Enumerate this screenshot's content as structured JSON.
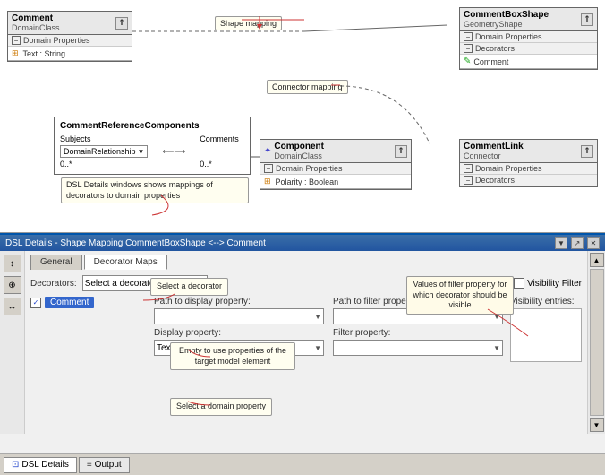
{
  "diagram": {
    "boxes": {
      "comment": {
        "title": "Comment",
        "subtitle": "DomainClass",
        "sections": [
          "Domain Properties"
        ],
        "properties": [
          "Text : String"
        ]
      },
      "commentboxshape": {
        "title": "CommentBoxShape",
        "subtitle": "GeometryShape",
        "sections": [
          "Domain Properties",
          "Decorators"
        ],
        "decorators": [
          "Comment"
        ]
      },
      "refcomponents": {
        "title": "CommentReferenceComponents",
        "subjects_label": "Subjects",
        "comments_label": "Comments",
        "relation": "DomainRelationship",
        "mult1": "0..*",
        "mult2": "0..*"
      },
      "component": {
        "title": "Component",
        "subtitle": "DomainClass",
        "sections": [
          "Domain Properties"
        ],
        "properties": [
          "Polarity : Boolean"
        ]
      },
      "commentlink": {
        "title": "CommentLink",
        "subtitle": "Connector",
        "sections": [
          "Domain Properties",
          "Decorators"
        ]
      }
    },
    "annotations": {
      "shape_mapping": "Shape mapping",
      "connector_mapping": "Connector mapping",
      "dsl_details": "DSL Details windows shows mappings of\ndecorators to domain properties"
    }
  },
  "dsl_panel": {
    "title": "DSL Details - Shape Mapping CommentBoxShape <--> Comment",
    "tabs": {
      "general": "General",
      "decorator_maps": "Decorator Maps"
    },
    "controls": {
      "pin": "▼",
      "close": "✕",
      "autosize": "↗"
    },
    "form": {
      "decorators_label": "Decorators:",
      "select_decorator": "Select a decorator",
      "visibility_filter_label": "Visibility Filter",
      "path_display_label": "Path to display property:",
      "path_filter_label": "Path to filter property:",
      "display_property_label": "Display property:",
      "filter_property_label": "Filter property:",
      "display_value": "Text",
      "comment_tag": "Comment",
      "visibility_entries_label": "Visibility entries:"
    },
    "annotations": {
      "select_decorator": "Select a decorator",
      "empty_path": "Empty to use properties of the\ntarget model element",
      "select_domain_property": "Select a domain property",
      "visibility_values": "Values of filter property for\nwhich decorator should be\nvisible"
    }
  },
  "bottom_tabs": {
    "dsl_details": "DSL Details",
    "output": "Output"
  }
}
